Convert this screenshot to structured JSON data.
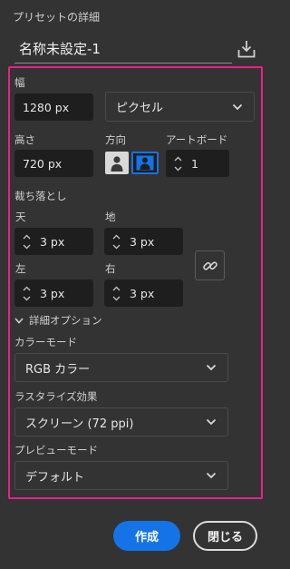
{
  "panel": {
    "header_title": "プリセットの詳細",
    "preset_name": "名称未設定-1"
  },
  "width": {
    "label": "幅",
    "value": "1280 px",
    "unit": "ピクセル"
  },
  "height": {
    "label": "高さ",
    "value": "720 px"
  },
  "orientation": {
    "label": "方向",
    "selected": "landscape"
  },
  "artboard": {
    "label": "アートボード",
    "value": "1"
  },
  "bleed": {
    "label": "裁ち落とし",
    "top_label": "天",
    "top_value": "3 px",
    "bottom_label": "地",
    "bottom_value": "3 px",
    "left_label": "左",
    "left_value": "3 px",
    "right_label": "右",
    "right_value": "3 px"
  },
  "advanced": {
    "toggle_label": "詳細オプション",
    "color_mode_label": "カラーモード",
    "color_mode_value": "RGB カラー",
    "raster_label": "ラスタライズ効果",
    "raster_value": "スクリーン (72 ppi)",
    "preview_label": "プレビューモード",
    "preview_value": "デフォルト"
  },
  "footer": {
    "create_label": "作成",
    "close_label": "閉じる"
  },
  "colors": {
    "accent": "#1473e6",
    "highlight_border": "#e8218c",
    "background": "#333333",
    "field_bg": "#1e1e1e"
  }
}
